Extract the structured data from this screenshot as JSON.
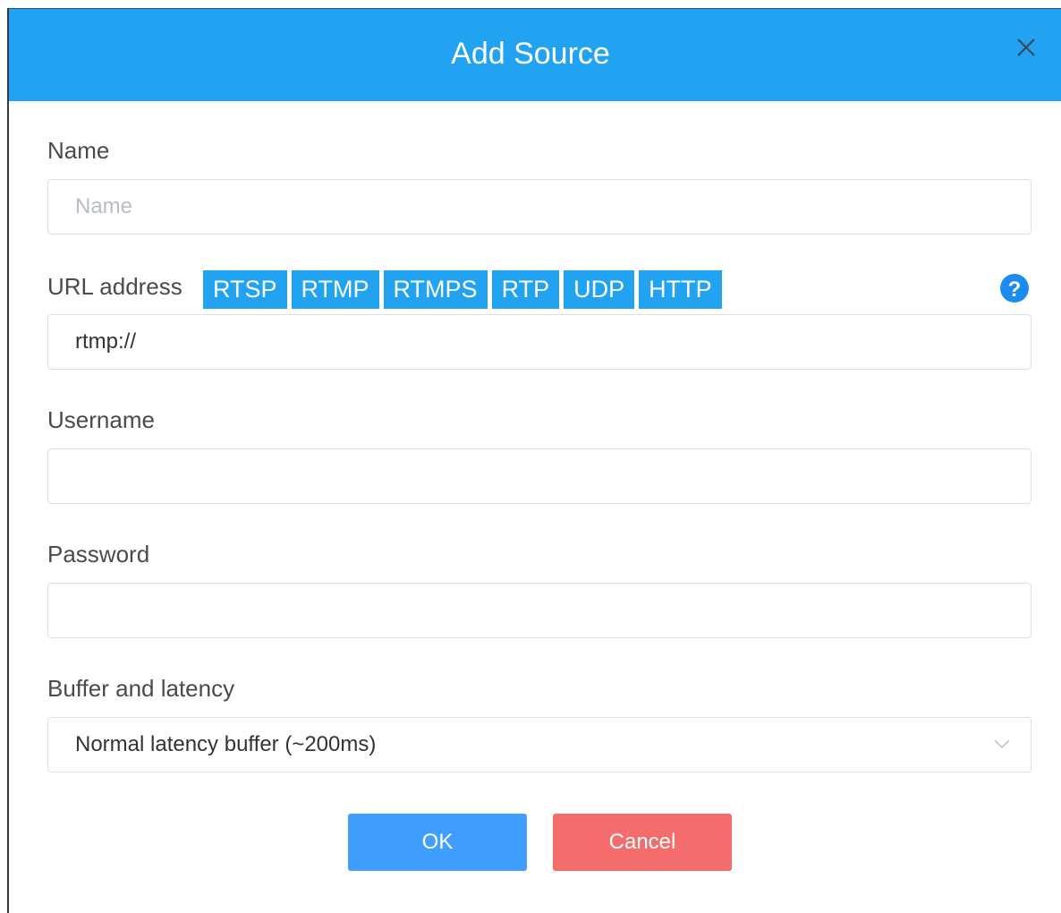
{
  "dialog": {
    "title": "Add Source",
    "close_icon": "close-icon",
    "header_color": "#21a3f1"
  },
  "form": {
    "name": {
      "label": "Name",
      "placeholder": "Name",
      "value": ""
    },
    "url": {
      "label": "URL address",
      "protocols": [
        "RTSP",
        "RTMP",
        "RTMPS",
        "RTP",
        "UDP",
        "HTTP"
      ],
      "value": "rtmp://",
      "help_icon": "question-circle-icon"
    },
    "username": {
      "label": "Username",
      "value": ""
    },
    "password": {
      "label": "Password",
      "value": ""
    },
    "buffer": {
      "label": "Buffer and latency",
      "selected": "Normal latency buffer (~200ms)",
      "chevron_icon": "chevron-down-icon"
    }
  },
  "actions": {
    "ok_label": "OK",
    "cancel_label": "Cancel",
    "ok_color": "#409eff",
    "cancel_color": "#f56c6c"
  }
}
